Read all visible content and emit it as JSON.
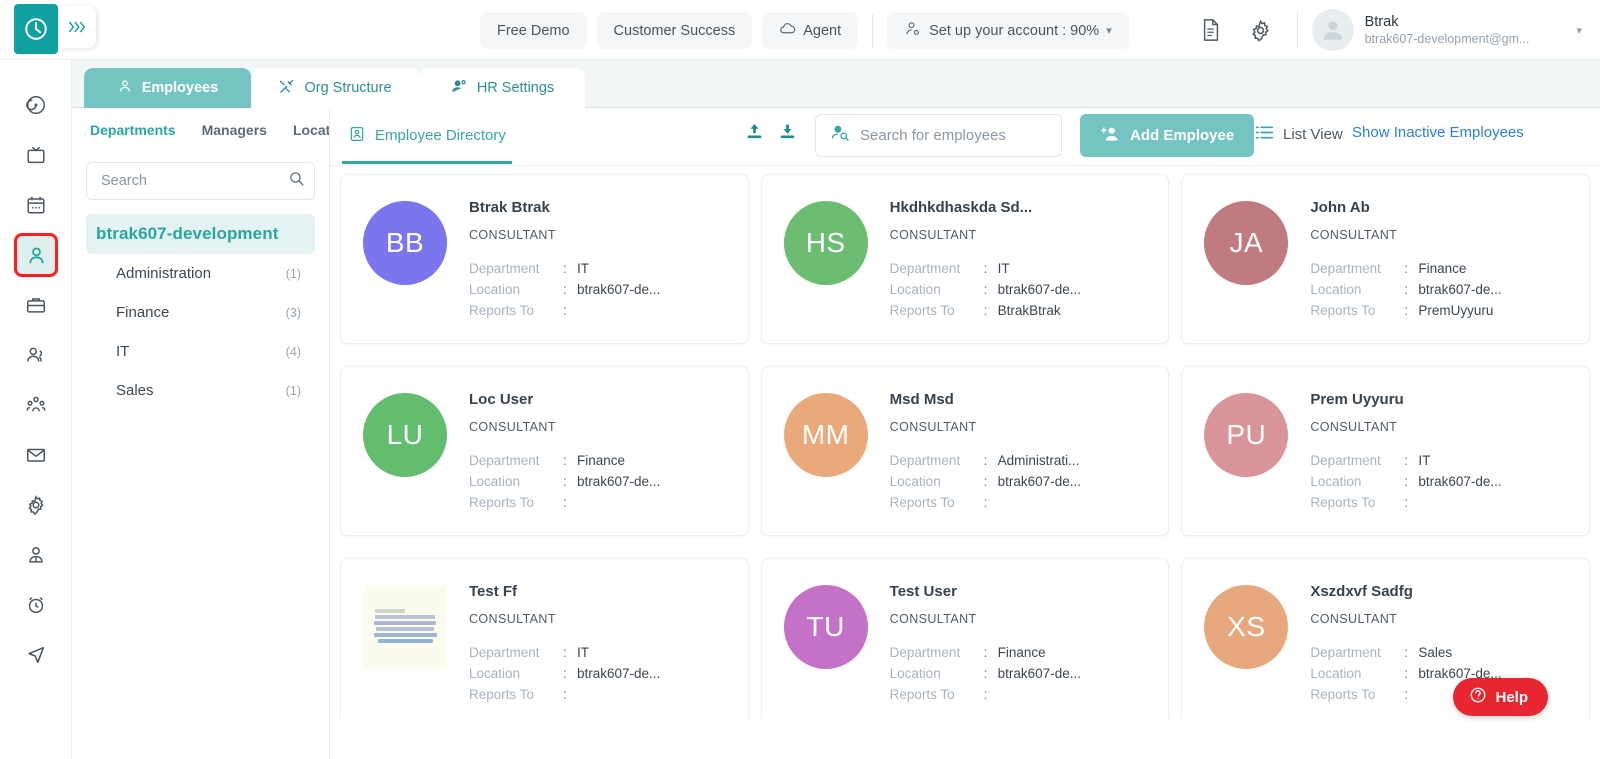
{
  "header": {
    "logo_icon": "clock-logo-icon",
    "expand_icon": "chevrons-right-icon",
    "free_demo": "Free Demo",
    "customer_success": "Customer Success",
    "agent": "Agent",
    "agent_icon": "cloud-icon",
    "setup_account": "Set up your account : 90%",
    "setup_icon": "user-gear-icon",
    "setup_caret": "▾",
    "doc_icon": "document-icon",
    "gear_icon": "gear-icon",
    "avatar_icon": "user-avatar-icon",
    "user_name": "Btrak",
    "user_email": "btrak607-development@gm...",
    "user_caret": "▾"
  },
  "rail": {
    "items": [
      {
        "icon": "target-dashboard-icon",
        "active": false
      },
      {
        "icon": "tv-monitor-icon",
        "active": false
      },
      {
        "icon": "calendar-icon",
        "active": false
      },
      {
        "icon": "person-hr-icon",
        "active": true
      },
      {
        "icon": "briefcase-icon",
        "active": false
      },
      {
        "icon": "users-pair-icon",
        "active": false
      },
      {
        "icon": "team-group-icon",
        "active": false
      },
      {
        "icon": "mail-envelope-icon",
        "active": false
      },
      {
        "icon": "settings-gear-icon",
        "active": false
      },
      {
        "icon": "user-profile-icon",
        "active": false
      },
      {
        "icon": "alarm-clock-icon",
        "active": false
      },
      {
        "icon": "send-navigate-icon",
        "active": false
      }
    ]
  },
  "tabs": [
    {
      "label": "Employees",
      "icon": "person-icon",
      "active": true
    },
    {
      "label": "Org Structure",
      "icon": "tools-icon",
      "active": false
    },
    {
      "label": "HR Settings",
      "icon": "user-settings-icon",
      "active": false
    }
  ],
  "filter_panel": {
    "tabs": [
      {
        "label": "Departments",
        "active": true
      },
      {
        "label": "Managers",
        "active": false
      },
      {
        "label": "Location",
        "active": false
      }
    ],
    "search_placeholder": "Search",
    "search_value": "",
    "search_icon": "search-icon",
    "org_root": "btrak607-development",
    "departments": [
      {
        "name": "Administration",
        "count": "(1)"
      },
      {
        "name": "Finance",
        "count": "(3)"
      },
      {
        "name": "IT",
        "count": "(4)"
      },
      {
        "name": "Sales",
        "count": "(1)"
      }
    ]
  },
  "toolbar": {
    "directory_tab": "Employee Directory",
    "directory_icon": "id-card-icon",
    "upload_icon": "upload-icon",
    "download_icon": "download-icon",
    "search_placeholder": "Search for employees",
    "search_value": "",
    "search_icon": "user-search-icon",
    "add_employee": "Add Employee",
    "add_icon": "user-plus-icon",
    "list_view": "List View",
    "list_view_icon": "list-icon",
    "show_inactive": "Show Inactive Employees"
  },
  "card_labels": {
    "department": "Department",
    "location": "Location",
    "reports_to": "Reports To",
    "colon": ":"
  },
  "employees": [
    {
      "name": "Btrak Btrak",
      "role": "CONSULTANT",
      "initials": "BB",
      "color": "#7b76ee",
      "department": "IT",
      "location": "btrak607-de...",
      "reports_to": "",
      "avatar_type": "initials"
    },
    {
      "name": "Hkdhkdhaskda Sd...",
      "role": "CONSULTANT",
      "initials": "HS",
      "color": "#6cbd72",
      "department": "IT",
      "location": "btrak607-de...",
      "reports_to": "BtrakBtrak",
      "avatar_type": "initials"
    },
    {
      "name": "John Ab",
      "role": "CONSULTANT",
      "initials": "JA",
      "color": "#c07b80",
      "department": "Finance",
      "location": "btrak607-de...",
      "reports_to": "PremUyyuru",
      "avatar_type": "initials"
    },
    {
      "name": "Loc User",
      "role": "CONSULTANT",
      "initials": "LU",
      "color": "#63bd6e",
      "department": "Finance",
      "location": "btrak607-de...",
      "reports_to": "",
      "avatar_type": "initials"
    },
    {
      "name": "Msd Msd",
      "role": "CONSULTANT",
      "initials": "MM",
      "color": "#eaa97b",
      "department": "Administrati...",
      "location": "btrak607-de...",
      "reports_to": "",
      "avatar_type": "initials"
    },
    {
      "name": "Prem Uyyuru",
      "role": "CONSULTANT",
      "initials": "PU",
      "color": "#d99499",
      "department": "IT",
      "location": "btrak607-de...",
      "reports_to": "",
      "avatar_type": "initials"
    },
    {
      "name": "Test Ff",
      "role": "CONSULTANT",
      "initials": "",
      "color": "#fbfbee",
      "department": "IT",
      "location": "btrak607-de...",
      "reports_to": "",
      "avatar_type": "photo"
    },
    {
      "name": "Test User",
      "role": "CONSULTANT",
      "initials": "TU",
      "color": "#c472c8",
      "department": "Finance",
      "location": "btrak607-de...",
      "reports_to": "",
      "avatar_type": "initials"
    },
    {
      "name": "Xszdxvf Sadfg",
      "role": "CONSULTANT",
      "initials": "XS",
      "color": "#e8a87e",
      "department": "Sales",
      "location": "btrak607-de...",
      "reports_to": "",
      "avatar_type": "initials"
    }
  ],
  "help": {
    "label": "Help",
    "icon": "question-circle-icon",
    "color": "#e8262f"
  },
  "theme": {
    "accent": "#2aa6a0",
    "tab_active": "#74c5c2",
    "link": "#2f7fd6",
    "selection": "#ff1d1d"
  }
}
